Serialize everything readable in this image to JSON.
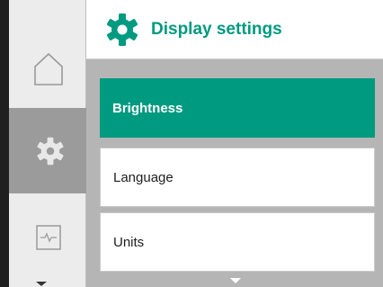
{
  "header": {
    "title": "Display settings",
    "icon": "gear-icon",
    "accent_color": "#009a80"
  },
  "sidebar": {
    "items": [
      {
        "icon": "home-icon",
        "selected": false
      },
      {
        "icon": "gear-icon",
        "selected": true
      },
      {
        "icon": "pulse-monitor-icon",
        "selected": false
      }
    ]
  },
  "menu": {
    "items": [
      {
        "label": "Brightness",
        "selected": true
      },
      {
        "label": "Language",
        "selected": false
      },
      {
        "label": "Units",
        "selected": false
      }
    ]
  }
}
